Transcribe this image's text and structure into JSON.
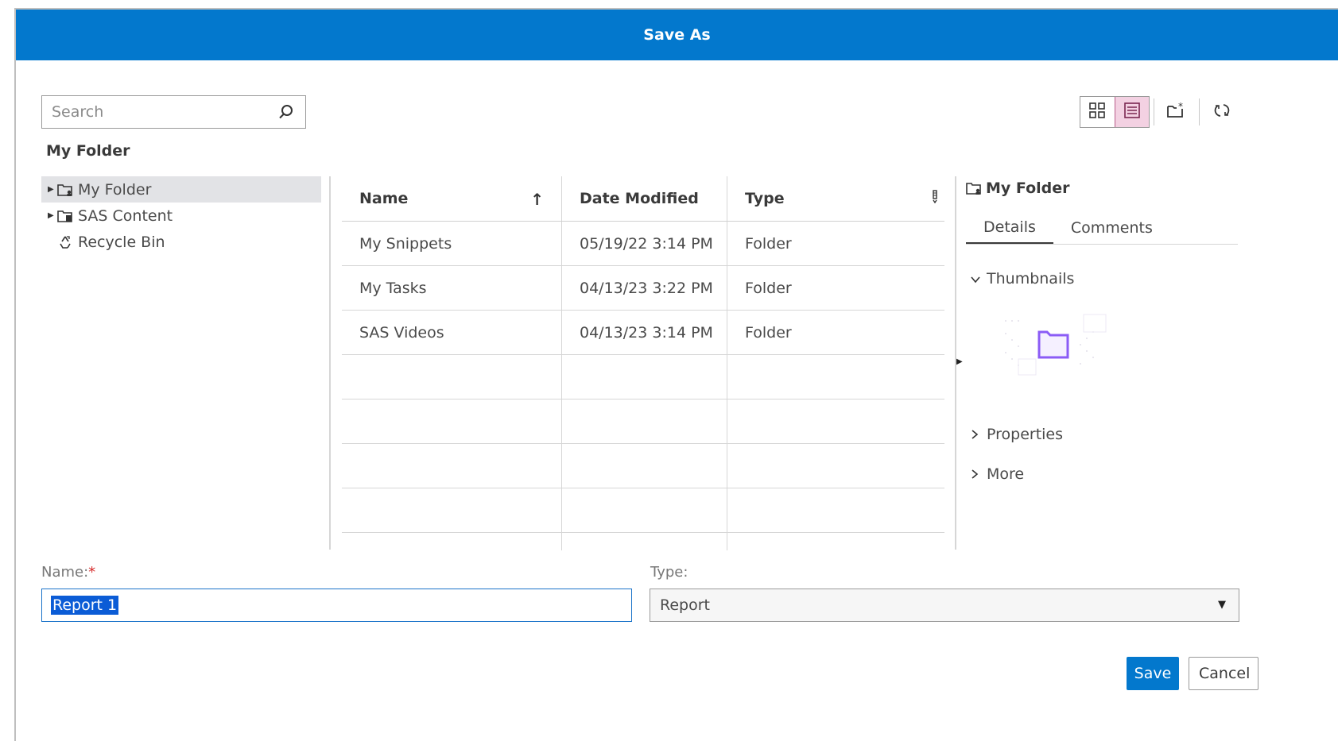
{
  "dialog": {
    "title": "Save As"
  },
  "search": {
    "placeholder": "Search",
    "icon": "search-icon"
  },
  "location": {
    "label": "My Folder"
  },
  "toolbar": {
    "icons": [
      "grid-view-icon",
      "list-view-icon",
      "new-folder-icon",
      "refresh-icon"
    ],
    "active_view": "list"
  },
  "tree": {
    "items": [
      {
        "label": "My Folder",
        "icon": "user-folder-icon",
        "expandable": true,
        "selected": true
      },
      {
        "label": "SAS Content",
        "icon": "content-folder-icon",
        "expandable": true,
        "selected": false
      },
      {
        "label": "Recycle Bin",
        "icon": "recycle-icon",
        "expandable": false,
        "selected": false
      }
    ]
  },
  "table": {
    "columns": [
      "Name",
      "Date Modified",
      "Type"
    ],
    "sort_indicator": "↑",
    "rows": [
      {
        "name": "My Snippets",
        "date": "05/19/22 3:14 PM",
        "type": "Folder"
      },
      {
        "name": "My Tasks",
        "date": "04/13/23 3:22 PM",
        "type": "Folder"
      },
      {
        "name": "SAS Videos",
        "date": "04/13/23 3:14 PM",
        "type": "Folder"
      }
    ]
  },
  "panel": {
    "title": "My Folder",
    "tabs": [
      "Details",
      "Comments"
    ],
    "active_tab": "Details",
    "sections": [
      {
        "label": "Thumbnails",
        "expanded": true
      },
      {
        "label": "Properties",
        "expanded": false
      },
      {
        "label": "More",
        "expanded": false
      }
    ]
  },
  "form": {
    "name_label": "Name:",
    "required_mark": "*",
    "name_value": "Report 1",
    "type_label": "Type:",
    "type_value": "Report"
  },
  "buttons": {
    "save": "Save",
    "cancel": "Cancel"
  },
  "colors": {
    "accent": "#0378cd",
    "active_toggle": "#f3d1e2",
    "thumbnail_folder": "#8b5cf6"
  }
}
